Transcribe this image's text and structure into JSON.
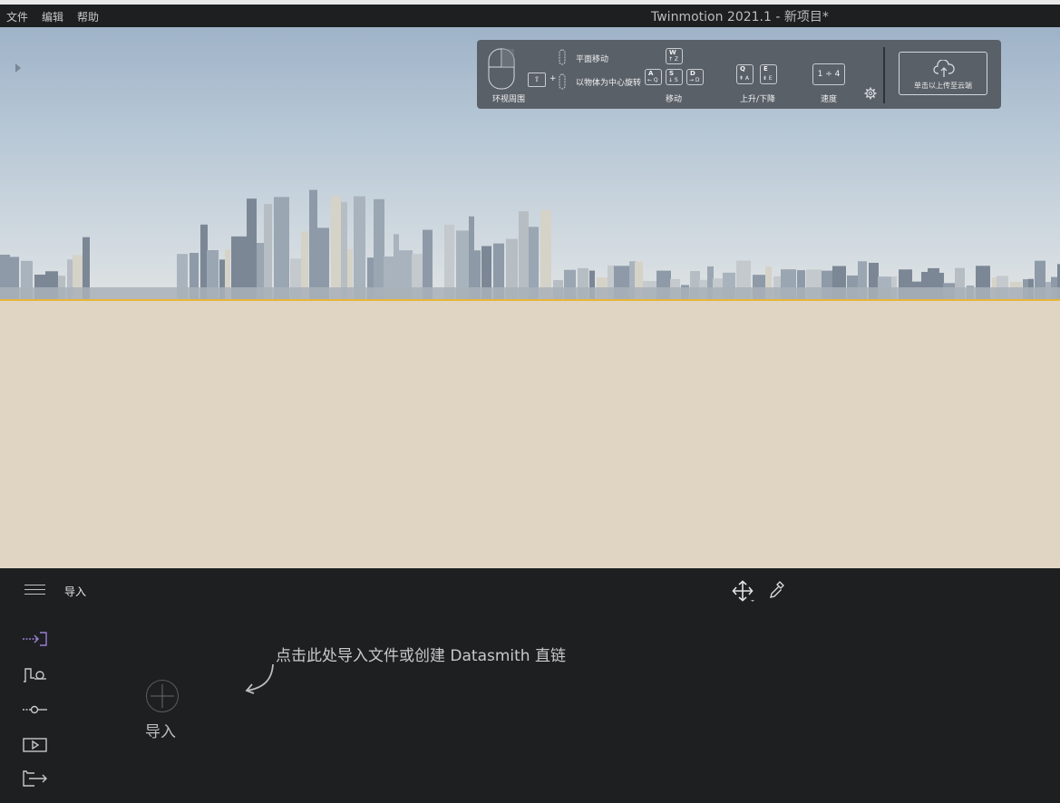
{
  "menu": {
    "file": "文件",
    "edit": "编辑",
    "help": "帮助"
  },
  "app_title": "Twinmotion 2021.1 - 新项目*",
  "nav_help": {
    "look_around": "环视周围",
    "pan": "平面移动",
    "orbit": "以物体为中心旋转",
    "shift_key": "⇧",
    "plus": "+",
    "move": "移动",
    "up_down": "上升/下降",
    "speed": "速度",
    "speed_value": "1 ÷ 4",
    "keys": {
      "w": {
        "top": "W",
        "bottom": "↑ Z"
      },
      "a": {
        "top": "A",
        "bottom": "← Q"
      },
      "s": {
        "top": "S",
        "bottom": "↓ S"
      },
      "d": {
        "top": "D",
        "bottom": "→ D"
      },
      "q": {
        "top": "Q",
        "bottom": "⇞ A"
      },
      "e": {
        "top": "E",
        "bottom": "⇟ E"
      }
    },
    "upload": "单击以上传至云端"
  },
  "bottom": {
    "section_title": "导入",
    "hint": "点击此处导入文件或创建 Datasmith 直链",
    "import_label": "导入"
  },
  "icons": {
    "sidebar": [
      "import-icon",
      "context-icon",
      "settings-slider-icon",
      "media-icon",
      "export-icon"
    ],
    "toolbar": [
      "move-gizmo-icon",
      "eyedropper-icon"
    ]
  },
  "colors": {
    "accent": "#9b7fd8",
    "horizon": "#e8b43a",
    "ground": "#e0d4c2"
  }
}
